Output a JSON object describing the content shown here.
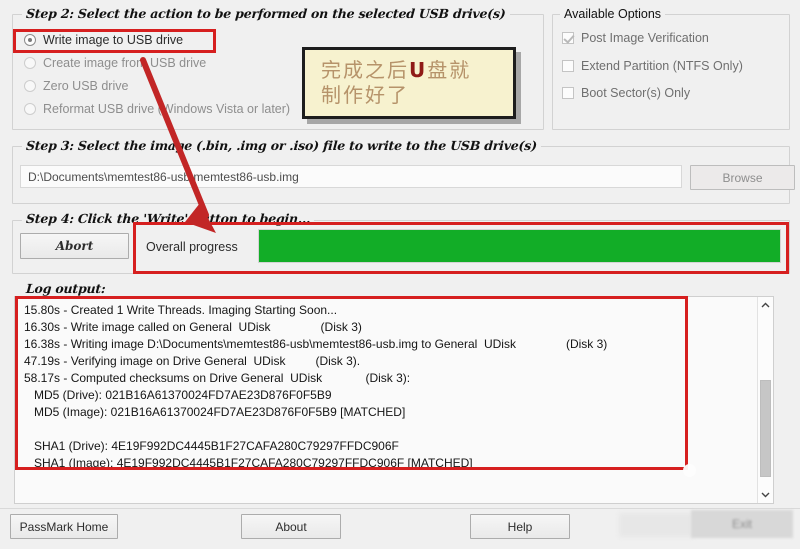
{
  "app": {
    "background": "#f0f0f0",
    "accent_red": "#d61f1f",
    "progress_green": "#12ad27"
  },
  "step2": {
    "title": "Step 2: Select the action to be performed on the selected USB drive(s)",
    "options": [
      {
        "label": "Write image to USB drive",
        "selected": true,
        "disabled": false
      },
      {
        "label": "Create image from USB drive",
        "selected": false,
        "disabled": true
      },
      {
        "label": "Zero USB drive",
        "selected": false,
        "disabled": true
      },
      {
        "label": "Reformat USB drive (Windows Vista or later)",
        "selected": false,
        "disabled": true
      }
    ]
  },
  "available_options": {
    "title": "Available Options",
    "items": [
      {
        "label": "Post Image Verification",
        "checked": true,
        "disabled": true
      },
      {
        "label": "Extend Partition (NTFS Only)",
        "checked": false,
        "disabled": true
      },
      {
        "label": "Boot Sector(s) Only",
        "checked": false,
        "disabled": true
      }
    ]
  },
  "step3": {
    "title": "Step 3: Select the image (.bin, .img or .iso) file to write to the USB drive(s)",
    "path_value": "D:\\Documents\\memtest86-usb\\memtest86-usb.img",
    "path_placeholder": "",
    "browse_label": "Browse"
  },
  "step4": {
    "title": "Step 4: Click the 'Write' button to begin...",
    "abort_label": "Abort",
    "progress_label": "Overall progress",
    "progress_percent": 100
  },
  "log": {
    "title": "Log output:",
    "lines": [
      "15.80s - Created 1 Write Threads. Imaging Starting Soon...",
      "16.30s - Write image called on General  UDisk               (Disk 3)",
      "16.38s - Writing image D:\\Documents\\memtest86-usb\\memtest86-usb.img to General  UDisk               (Disk 3)",
      "47.19s - Verifying image on Drive General  UDisk         (Disk 3).",
      "58.17s - Computed checksums on Drive General  UDisk             (Disk 3):",
      "   MD5 (Drive): 021B16A61370024FD7AE23D876F0F5B9",
      "   MD5 (Image): 021B16A61370024FD7AE23D876F0F5B9 [MATCHED]",
      "",
      "   SHA1 (Drive): 4E19F992DC4445B1F27CAFA280C79297FFDC906F",
      "   SHA1 (Image): 4E19F992DC4445B1F27CAFA280C79297FFDC906F [MATCHED]"
    ],
    "scroll_up": "⌃",
    "scroll_down": "⌄"
  },
  "footer": {
    "passmark_label": "PassMark Home",
    "about_label": "About",
    "help_label": "Help",
    "exit_label": "Exit"
  },
  "annotation": {
    "note_line1_pre": "完成之后",
    "note_line1_bold": "U",
    "note_line1_post": "盘就",
    "note_line2": "制作好了"
  }
}
